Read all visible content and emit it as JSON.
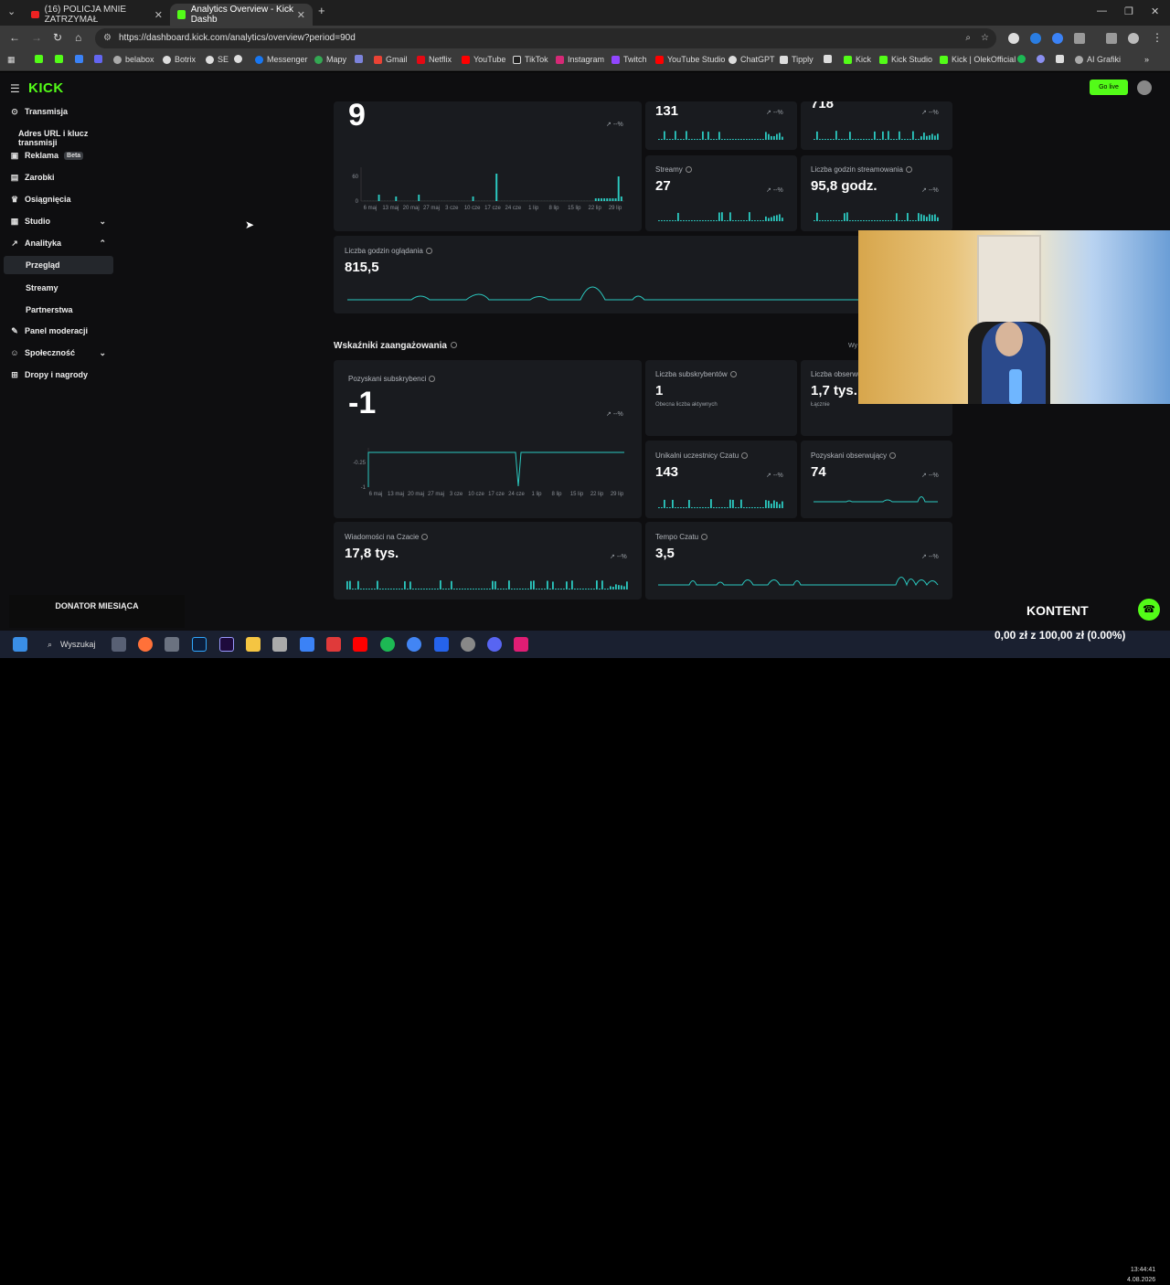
{
  "browser": {
    "tabs": [
      {
        "label": "(16) POLICJA MNIE ZATRZYMAŁ"
      },
      {
        "label": "Analytics Overview - Kick Dashb"
      }
    ],
    "url": "https://dashboard.kick.com/analytics/overview?period=90d",
    "bookmarks": [
      "belabox",
      "Botrix",
      "SE",
      "Messenger",
      "Mapy",
      "Gmail",
      "Netflix",
      "YouTube",
      "TikTok",
      "Instagram",
      "Twitch",
      "YouTube Studio",
      "ChatGPT",
      "Tipply",
      "Kick",
      "Kick Studio",
      "Kick | OlekOfficial",
      "AI Grafiki"
    ]
  },
  "sidebar": {
    "logo": "KICK",
    "items": [
      {
        "label": "Transmisja"
      },
      {
        "label": "Adres URL i klucz transmisji"
      },
      {
        "label": "Reklama",
        "badge": "Beta"
      },
      {
        "label": "Zarobki"
      },
      {
        "label": "Osiągnięcia"
      },
      {
        "label": "Studio"
      },
      {
        "label": "Analityka"
      },
      {
        "label": "Przegląd"
      },
      {
        "label": "Streamy"
      },
      {
        "label": "Partnerstwa"
      },
      {
        "label": "Panel moderacji"
      },
      {
        "label": "Społeczność"
      },
      {
        "label": "Dropy i nagrody"
      }
    ]
  },
  "header": {
    "go_live": "Go live"
  },
  "cards": {
    "top_left": {
      "value": "9",
      "trend": "--%"
    },
    "c131": {
      "value": "131",
      "trend": "--%"
    },
    "c718": {
      "value": "718",
      "trend": "--%"
    },
    "streams": {
      "label": "Streamy",
      "value": "27",
      "trend": "--%"
    },
    "hours_streamed": {
      "label": "Liczba godzin streamowania",
      "value": "95,8 godz.",
      "trend": "--%"
    },
    "watch_hours": {
      "label": "Liczba godzin oglądania",
      "value": "815,5"
    },
    "engagement_title": "Wskaźniki zaangażowania",
    "subs_gained": {
      "label": "Pozyskani subskrybenci",
      "value": "-1",
      "trend": "--%"
    },
    "subs_count": {
      "label": "Liczba subskrybentów",
      "value": "1",
      "sub": "Obecna liczba aktywnych"
    },
    "followers": {
      "label": "Liczba obserwu",
      "value": "1,7 tys.",
      "sub": "Łącznie"
    },
    "chatters": {
      "label": "Unikalni uczestnicy Czatu",
      "value": "143",
      "trend": "--%"
    },
    "followers_gained": {
      "label": "Pozyskani obserwujący",
      "value": "74",
      "trend": "--%"
    },
    "messages": {
      "label": "Wiadomości na Czacie",
      "value": "17,8 tys.",
      "trend": "--%"
    },
    "chat_pace": {
      "label": "Tempo Czatu",
      "value": "3,5",
      "trend": "--%"
    },
    "peek": "Wy"
  },
  "chart_data": [
    {
      "type": "bar",
      "title": "",
      "x": [
        "6 maj",
        "13 maj",
        "20 maj",
        "27 maj",
        "3 cze",
        "10 cze",
        "17 cze",
        "24 cze",
        "1 lip",
        "8 lip",
        "15 lip",
        "22 lip",
        "29 lip"
      ],
      "yticks": [
        "60",
        "0"
      ],
      "values": [
        0,
        0,
        0,
        0,
        0,
        3,
        0,
        0,
        0,
        0,
        0,
        2,
        0,
        0,
        0,
        0,
        0,
        0,
        0,
        3,
        0,
        0,
        0,
        0,
        0,
        0,
        0,
        0,
        0,
        0,
        0,
        0,
        0,
        0,
        0,
        0,
        0,
        0,
        2,
        0,
        0,
        0,
        0,
        0,
        0,
        0,
        0,
        0,
        0,
        0,
        0,
        0,
        0,
        0,
        0,
        0,
        0,
        0,
        0,
        0,
        0,
        0,
        0,
        0,
        0,
        0,
        0,
        0,
        0,
        0,
        0,
        0,
        0,
        0,
        0,
        0,
        0,
        0,
        0,
        0,
        0,
        1,
        1,
        1,
        1,
        1,
        1,
        1,
        1,
        1,
        2
      ],
      "highlight": {
        "index": 17,
        "value": 60
      }
    },
    {
      "type": "line",
      "title": "",
      "x": [
        "6 maj",
        "13 maj",
        "20 maj",
        "27 maj",
        "3 cze",
        "10 cze",
        "17 cze",
        "24 cze",
        "1 lip",
        "8 lip",
        "15 lip",
        "22 lip",
        "29 lip"
      ],
      "yticks": [
        "-0.25",
        "-1"
      ],
      "dip_index": 7,
      "dip_value": -1
    }
  ],
  "overlay": {
    "donator": "DONATOR MIESIĄCA",
    "kontent": "KONTENT"
  },
  "taskbar": {
    "search": "Wyszukaj",
    "money": "0,00 zł z 100,00 zł (0.00%)",
    "time": "13:44:41",
    "date": "4.08.2026"
  }
}
